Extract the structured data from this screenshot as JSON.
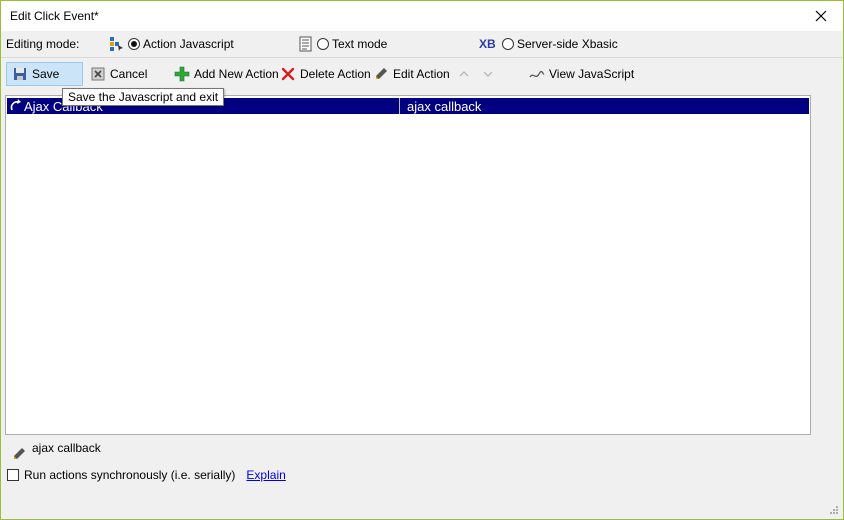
{
  "window": {
    "title": "Edit Click Event*",
    "close_icon": "close-icon"
  },
  "editing_mode": {
    "label": "Editing mode:",
    "options": [
      {
        "label": "Action Javascript",
        "selected": true,
        "icon": "action-javascript-icon"
      },
      {
        "label": "Text mode",
        "selected": false,
        "icon": "text-mode-icon"
      },
      {
        "label": "Server-side Xbasic",
        "selected": false,
        "icon": "xbasic-icon",
        "icon_text": "XB"
      }
    ]
  },
  "toolbar": {
    "save_label": "Save",
    "cancel_label": "Cancel",
    "add_label": "Add New Action",
    "delete_label": "Delete Action",
    "edit_label": "Edit Action",
    "view_js_label": "View JavaScript",
    "save_tooltip": "Save the Javascript and exit"
  },
  "actions_list": {
    "rows": [
      {
        "name": "Ajax Callback",
        "description": "ajax callback",
        "selected": true
      }
    ]
  },
  "footer": {
    "current_action": "ajax callback",
    "sync_label": "Run actions synchronously (i.e. serially)",
    "sync_checked": false,
    "explain_link": "Explain"
  },
  "colors": {
    "selection": "#000080",
    "pressed_button": "#cce4f7",
    "link": "#0000ee",
    "window_border": "#9cbf3a"
  }
}
